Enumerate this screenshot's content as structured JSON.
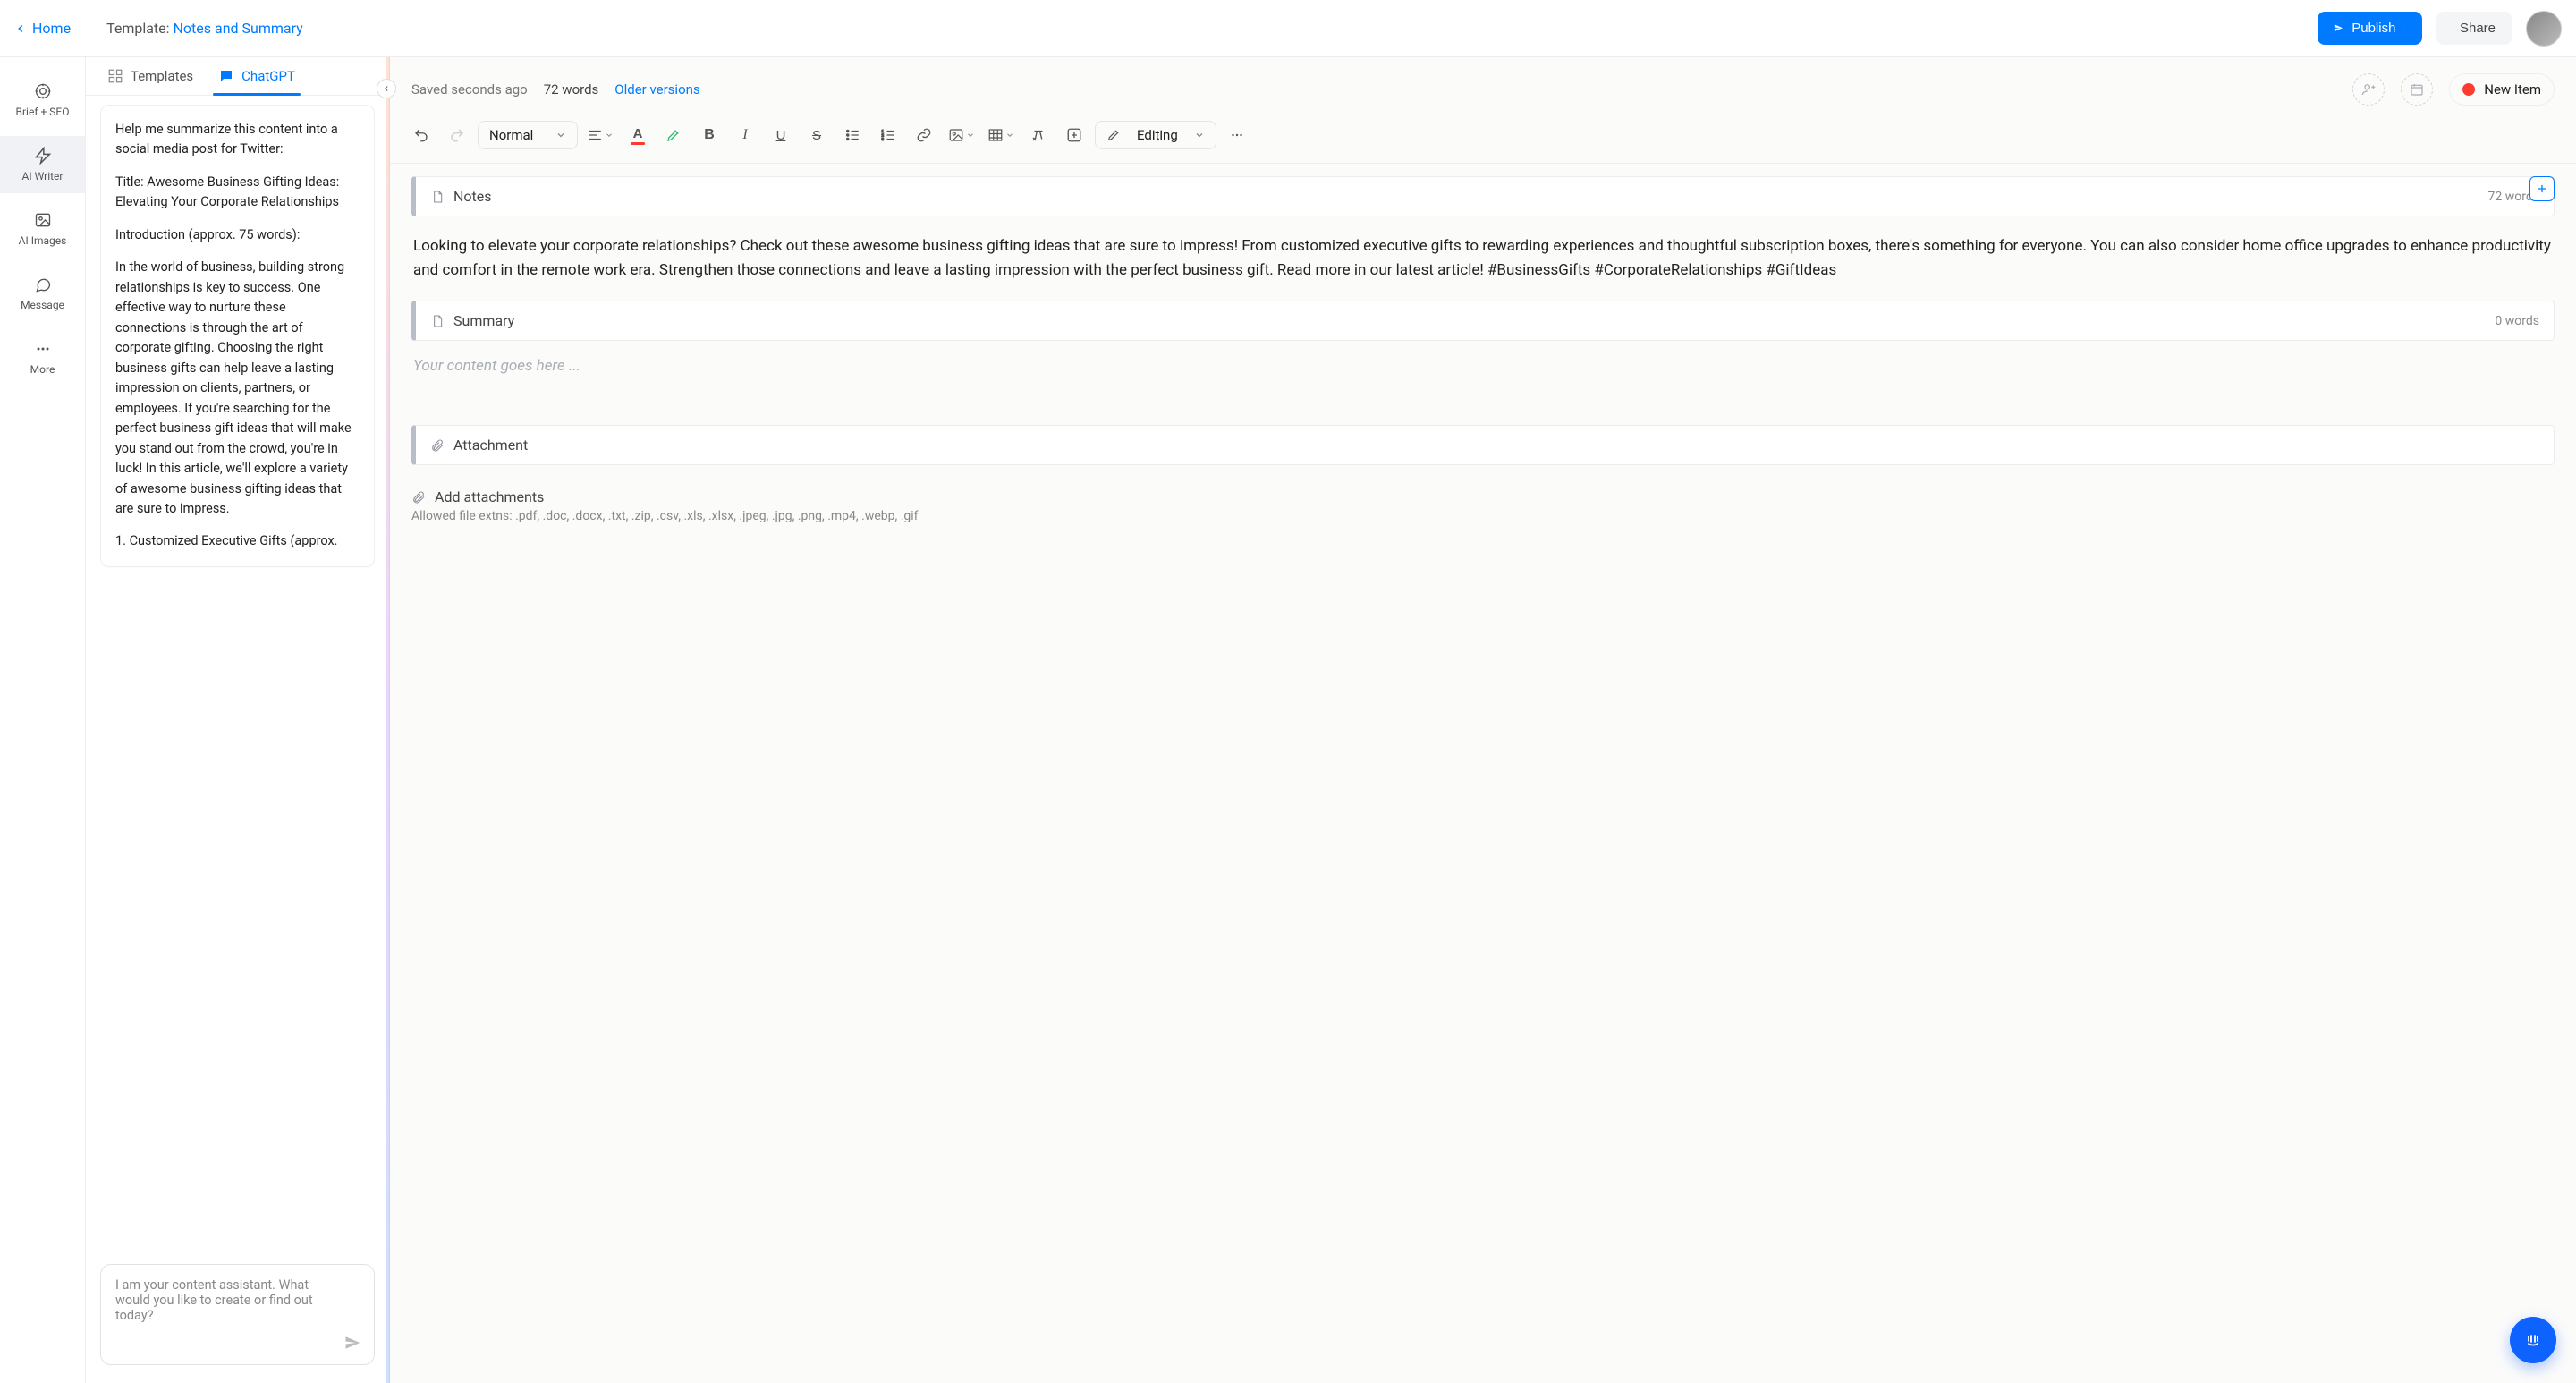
{
  "header": {
    "home": "Home",
    "template_prefix": "Template: ",
    "template_name": "Notes and Summary",
    "publish": "Publish",
    "share": "Share"
  },
  "rail": {
    "items": [
      {
        "icon": "brief-seo-icon",
        "label": "Brief + SEO"
      },
      {
        "icon": "writer-icon",
        "label": "AI Writer"
      },
      {
        "icon": "images-icon",
        "label": "AI Images"
      },
      {
        "icon": "message-icon",
        "label": "Message"
      },
      {
        "icon": "more-icon",
        "label": "More"
      }
    ]
  },
  "left": {
    "tab_templates": "Templates",
    "tab_chatgpt": "ChatGPT",
    "chat_paragraphs": [
      "Help me summarize this content into a social media post for Twitter:",
      "Title: Awesome Business Gifting Ideas: Elevating Your Corporate Relationships",
      "Introduction (approx. 75 words):",
      "In the world of business, building strong relationships is key to success. One effective way to nurture these connections is through the art of corporate gifting. Choosing the right business gifts can help leave a lasting impression on clients, partners, or employees. If you're searching for the perfect business gift ideas that will make you stand out from the crowd, you're in luck! In this article, we'll explore a variety of awesome business gifting ideas that are sure to impress.",
      "1. Customized Executive Gifts (approx."
    ],
    "input_placeholder": "I am your content assistant. What would you like to create or find out today?"
  },
  "status": {
    "saved": "Saved seconds ago",
    "words": "72 words",
    "older": "Older versions",
    "status_label": "New Item"
  },
  "toolbar": {
    "style": "Normal",
    "editing": "Editing"
  },
  "sections": {
    "notes": {
      "label": "Notes",
      "wc": "72 words",
      "body": "Looking to elevate your corporate relationships? Check out these awesome business gifting ideas that are sure to impress! From customized executive gifts to rewarding experiences and thoughtful subscription boxes, there's something for everyone. You can also consider home office upgrades to enhance productivity and comfort in the remote work era. Strengthen those connections and leave a lasting impression with the perfect business gift. Read more in our latest article! #BusinessGifts #CorporateRelationships #GiftIdeas"
    },
    "summary": {
      "label": "Summary",
      "wc": "0 words",
      "placeholder": "Your content goes here ..."
    },
    "attachment": {
      "label": "Attachment"
    }
  },
  "attach": {
    "add": "Add attachments",
    "ext": "Allowed file extns: .pdf, .doc, .docx, .txt, .zip, .csv, .xls, .xlsx, .jpeg, .jpg, .png, .mp4, .webp, .gif"
  }
}
